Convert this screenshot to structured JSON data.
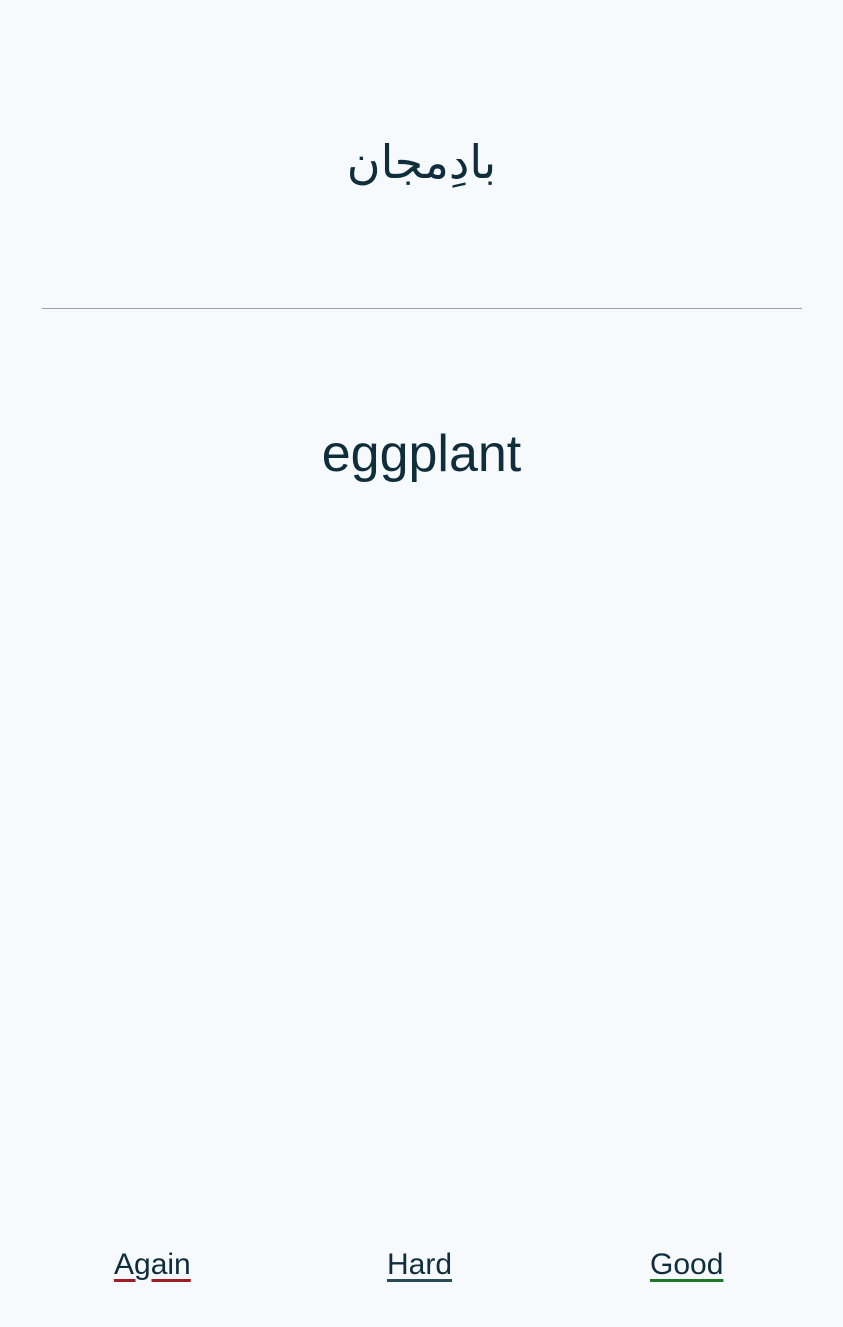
{
  "card": {
    "front": "بادِمجان",
    "back": "eggplant"
  },
  "answers": {
    "again": "Again",
    "hard": "Hard",
    "good": "Good"
  },
  "colors": {
    "background": "#f6fafd",
    "text": "#0f2d3a",
    "again_underline": "#a11d21",
    "hard_underline": "#2b4d59",
    "good_underline": "#1a7a2a"
  }
}
